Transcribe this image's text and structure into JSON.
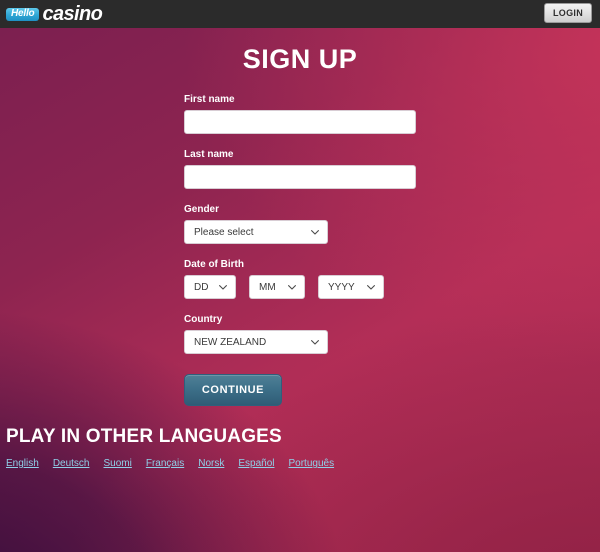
{
  "header": {
    "logo_badge": "Hello",
    "logo_word": "casino",
    "login_label": "LOGIN"
  },
  "main": {
    "title": "SIGN UP",
    "fields": {
      "first_name": {
        "label": "First name",
        "value": "",
        "placeholder": ""
      },
      "last_name": {
        "label": "Last name",
        "value": "",
        "placeholder": ""
      },
      "gender": {
        "label": "Gender",
        "selected": "Please select"
      },
      "dob": {
        "label": "Date of Birth",
        "day": "DD",
        "month": "MM",
        "year": "YYYY"
      },
      "country": {
        "label": "Country",
        "selected": "NEW ZEALAND"
      }
    },
    "continue_label": "CONTINUE"
  },
  "languages": {
    "heading": "PLAY IN OTHER LANGUAGES",
    "items": [
      {
        "label": "English"
      },
      {
        "label": "Deutsch"
      },
      {
        "label": "Suomi"
      },
      {
        "label": "Français"
      },
      {
        "label": "Norsk"
      },
      {
        "label": "Español"
      },
      {
        "label": "Português"
      }
    ]
  },
  "colors": {
    "header_bg": "#2b2b2b",
    "logo_badge_bg": "#2ea6d4",
    "bg_top_left": "#7a1f50",
    "bg_top_right": "#b32e57",
    "bg_bottom_left": "#3d1140",
    "bg_bottom_right": "#8d2043",
    "continue_button": "#3d7089",
    "link": "#8fd0e8"
  },
  "icons": {
    "chevron_down": "chevron-down-icon"
  }
}
